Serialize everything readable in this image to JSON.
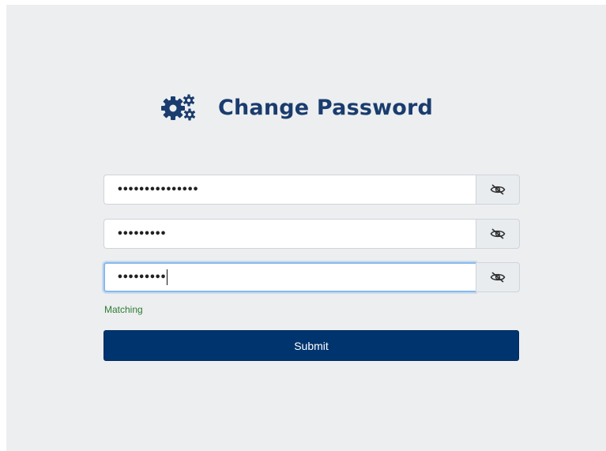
{
  "header": {
    "title": "Change Password",
    "icon": "gears-icon"
  },
  "form": {
    "fields": [
      {
        "masked_value": "•••••••••••••••",
        "toggle_icon": "eye-slash-icon",
        "focused": false
      },
      {
        "masked_value": "•••••••••",
        "toggle_icon": "eye-slash-icon",
        "focused": false
      },
      {
        "masked_value": "•••••••••",
        "toggle_icon": "eye-slash-icon",
        "focused": true
      }
    ],
    "match_status": "Matching",
    "submit_label": "Submit"
  },
  "colors": {
    "brand": "#1a3c6e",
    "button": "#00346f",
    "success": "#2e7d32",
    "background": "#eceef0"
  }
}
